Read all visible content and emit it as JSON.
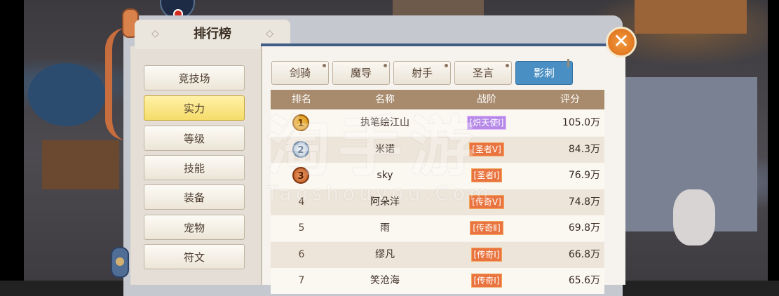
{
  "title": "排行榜",
  "close_symbol": "✕",
  "sidebar": {
    "items": [
      {
        "label": "竞技场"
      },
      {
        "label": "实力"
      },
      {
        "label": "等级"
      },
      {
        "label": "技能"
      },
      {
        "label": "装备"
      },
      {
        "label": "宠物"
      },
      {
        "label": "符文"
      }
    ],
    "active_index": 1
  },
  "tabs": [
    {
      "label": "剑骑"
    },
    {
      "label": "魔导"
    },
    {
      "label": "射手"
    },
    {
      "label": "圣言"
    },
    {
      "label": "影刺"
    }
  ],
  "active_tab_index": 4,
  "table": {
    "headers": {
      "rank": "排名",
      "name": "名称",
      "stage": "战阶",
      "score": "评分"
    },
    "rows": [
      {
        "rank": "1",
        "name": "执笔绘江山",
        "stage": "[炽天使Ⅰ]",
        "score": "105.0万"
      },
      {
        "rank": "2",
        "name": "米诺",
        "stage": "[圣者Ⅴ]",
        "score": "84.3万"
      },
      {
        "rank": "3",
        "name": "sky",
        "stage": "[圣者Ⅰ]",
        "score": "76.9万"
      },
      {
        "rank": "4",
        "name": "阿朵洋",
        "stage": "[传奇Ⅴ]",
        "score": "74.8万"
      },
      {
        "rank": "5",
        "name": "雨",
        "stage": "[传奇Ⅱ]",
        "score": "69.8万"
      },
      {
        "rank": "6",
        "name": "缪凡",
        "stage": "[传奇Ⅰ]",
        "score": "66.8万"
      },
      {
        "rank": "7",
        "name": "笑沧海",
        "stage": "[传奇Ⅰ]",
        "score": "65.6万"
      }
    ]
  },
  "watermark": {
    "text_cn": "淘手游",
    "text_en": "Taoshouyou.Com"
  },
  "colors": {
    "active_tab": "#4a8fc3",
    "active_menu": "#f5dc69",
    "close_button": "#e0761f"
  }
}
